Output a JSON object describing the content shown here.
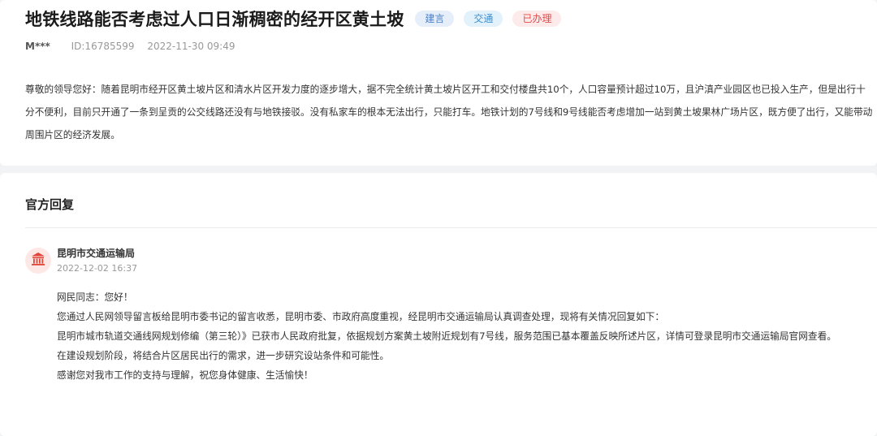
{
  "post": {
    "title": "地铁线路能否考虑过人口日渐稠密的经开区黄土坡",
    "tags": [
      "建言",
      "交通",
      "已办理"
    ],
    "user": "M***",
    "id_text": "ID:16785599",
    "datetime": "2022-11-30 09:49",
    "message": "尊敬的领导您好：随着昆明市经开区黄土坡片区和清水片区开发力度的逐步增大，据不完全统计黄土坡片区开工和交付楼盘共10个，人口容量预计超过10万，且沪滇产业园区也已投入生产，但是出行十分不便利，目前只开通了一条到呈贡的公交线路还没有与地铁接驳。没有私家车的根本无法出行，只能打车。地铁计划的7号线和9号线能否考虑增加一站到黄土坡果林广场片区，既方便了出行，又能带动周围片区的经济发展。"
  },
  "reply": {
    "section_title": "官方回复",
    "department": "昆明市交通运输局",
    "datetime": "2022-12-02 16:37",
    "paragraphs": [
      "网民同志：您好！",
      "您通过人民网领导留言板给昆明市委书记的留言收悉，昆明市委、市政府高度重视，经昆明市交通运输局认真调查处理，现将有关情况回复如下：",
      "昆明市城市轨道交通线网规划修编（第三轮）》已获市人民政府批复，依据规划方案黄土坡附近规划有7号线，服务范围已基本覆盖反映所述片区，详情可登录昆明市交通运输局官网查看。",
      "在建设规划阶段，将结合片区居民出行的需求，进一步研究设站条件和可能性。",
      "感谢您对我市工作的支持与理解，祝您身体健康、生活愉快！"
    ]
  },
  "icons": {
    "department_avatar": "government-building-icon"
  },
  "colors": {
    "avatar_bg": "#fde8e6",
    "avatar_icon": "#e0453a",
    "tag_red": "#e04b4b",
    "tag_blue": "#4a7fc4"
  }
}
